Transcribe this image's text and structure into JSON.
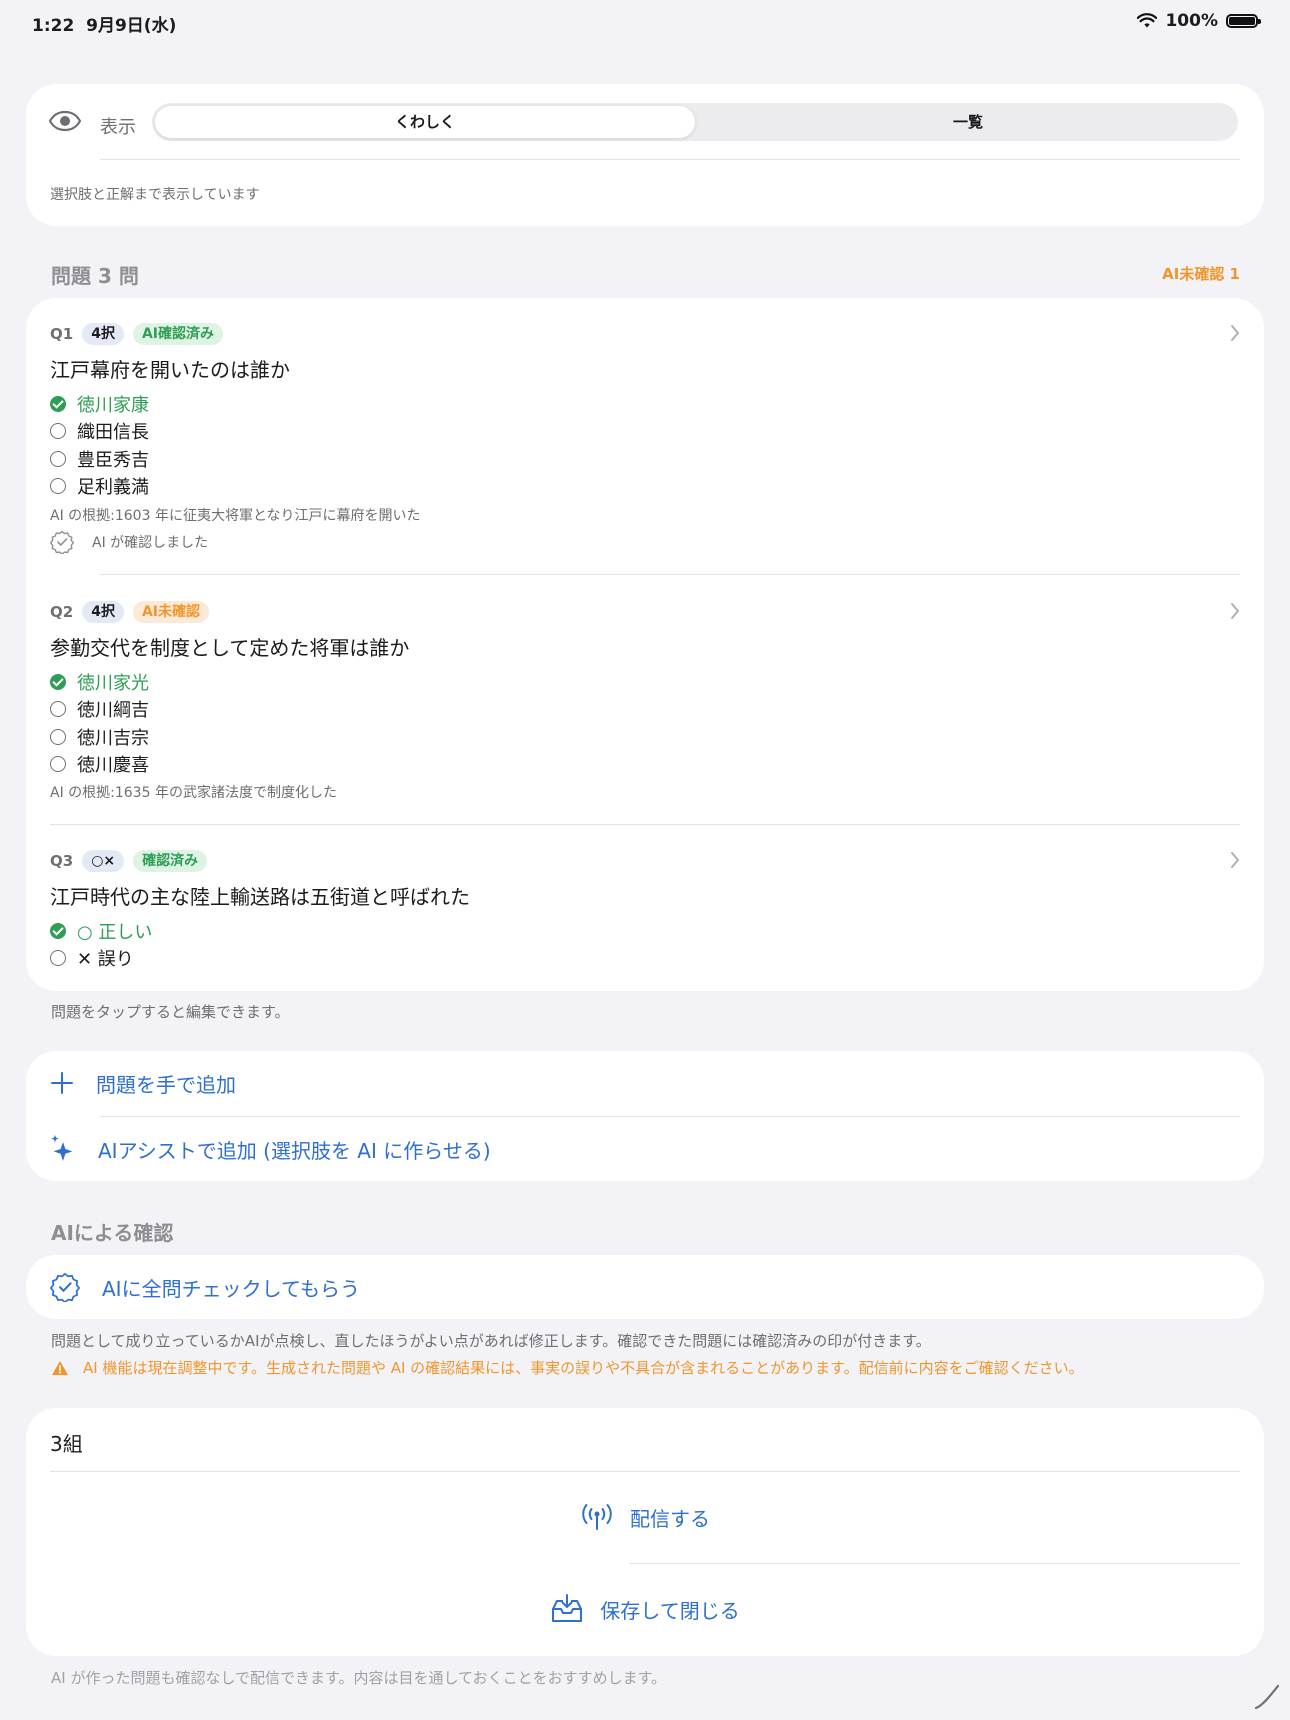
{
  "status_bar": {
    "time": "1:22",
    "date": "9月9日(水)",
    "battery": "100%"
  },
  "display": {
    "label": "表示",
    "segments": [
      "くわしく",
      "一覧"
    ],
    "selected": "くわしく",
    "note": "選択肢と正解まで表示しています"
  },
  "questions_header": {
    "title": "問題 3 問",
    "ai_unconfirmed": "AI未確認 1"
  },
  "questions": [
    {
      "num": "Q1",
      "type": "4択",
      "status": "AI確認済み",
      "text": "江戸幕府を開いたのは誰か",
      "choices": [
        "徳川家康",
        "織田信長",
        "豊臣秀吉",
        "足利義満"
      ],
      "correct": "徳川家康",
      "reason": "AI の根拠:1603 年に征夷大将軍となり江戸に幕府を開いた",
      "ai_confirmed": "AI が確認しました"
    },
    {
      "num": "Q2",
      "type": "4択",
      "status": "AI未確認",
      "text": "参勤交代を制度として定めた将軍は誰か",
      "choices": [
        "徳川家光",
        "徳川綱吉",
        "徳川吉宗",
        "徳川慶喜"
      ],
      "correct": "徳川家光",
      "reason": "AI の根拠:1635 年の武家諸法度で制度化した"
    },
    {
      "num": "Q3",
      "type": "○×",
      "status": "確認済み",
      "text": "江戸時代の主な陸上輸送路は五街道と呼ばれた",
      "choices": [
        "○ 正しい",
        "✕ 誤り"
      ],
      "correct": "○ 正しい"
    }
  ],
  "tap_hint": "問題をタップすると編集できます。",
  "add": {
    "manual": "問題を手で追加",
    "ai_assist": "AIアシストで追加 (選択肢を AI に作らせる)"
  },
  "ai_check": {
    "section_title": "AIによる確認",
    "button": "AIに全問チェックしてもらう",
    "description": "問題として成り立っているかAIが点検し、直したほうがよい点があれば修正します。確認できた問題には確認済みの印が付きます。",
    "warning": "AI 機能は現在調整中です。生成された問題や AI の確認結果には、事実の誤りや不具合が含まれることがあります。配信前に内容をご確認ください。"
  },
  "distribution": {
    "class_name": "3組",
    "distribute": "配信する",
    "save_close": "保存して閉じる"
  },
  "footnote": "AI が作った問題も確認なしで配信できます。内容は目を通しておくことをおすすめします。",
  "colors": {
    "accent": "#2f6fd1",
    "success": "#2f9e55",
    "warning": "#f0962c",
    "background": "#f2f2f7"
  }
}
